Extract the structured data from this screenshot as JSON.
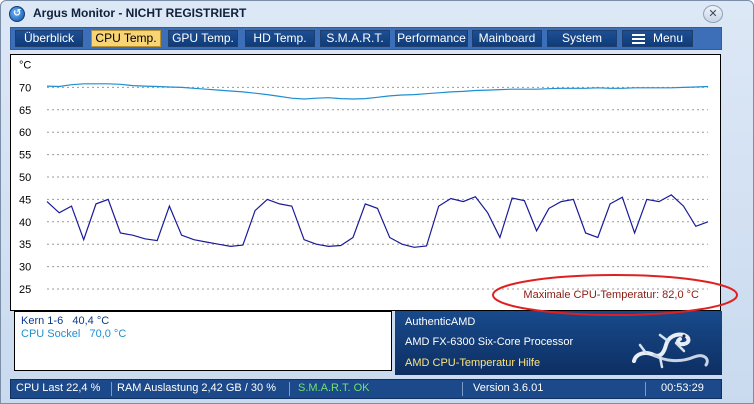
{
  "window": {
    "title": "Argus Monitor - NICHT REGISTRIERT",
    "close_icon": "close-icon"
  },
  "tabs": [
    {
      "label": "Überblick"
    },
    {
      "label": "CPU Temp.",
      "active": true
    },
    {
      "label": "GPU Temp."
    },
    {
      "label": "HD Temp."
    },
    {
      "label": "S.M.A.R.T."
    },
    {
      "label": "Performance"
    },
    {
      "label": "Mainboard"
    },
    {
      "label": "System"
    },
    {
      "label": "Menu",
      "icon": "menu-icon"
    }
  ],
  "chart_data": {
    "type": "line",
    "ylabel": "°C",
    "ylim": [
      25,
      75
    ],
    "yticks": [
      25,
      30,
      35,
      40,
      45,
      50,
      55,
      60,
      65,
      70
    ],
    "grid": true,
    "max_label": "Maximale CPU-Temperatur: 82,0 °C",
    "series": [
      {
        "name": "CPU Sockel",
        "color": "#1e8fd0",
        "values": [
          70.3,
          70.2,
          70.6,
          70.8,
          70.8,
          70.8,
          70.7,
          70.4,
          70.3,
          70.2,
          70.1,
          70.0,
          69.8,
          69.6,
          69.4,
          69.2,
          69.0,
          68.7,
          68.4,
          68.0,
          67.6,
          67.4,
          67.6,
          67.7,
          67.5,
          67.4,
          67.5,
          67.8,
          68.1,
          68.3,
          68.4,
          68.6,
          68.8,
          69.0,
          69.1,
          69.3,
          69.4,
          69.5,
          69.6,
          69.6,
          69.6,
          69.7,
          69.8,
          69.8,
          69.8,
          69.9,
          69.8,
          69.8,
          69.9,
          69.9,
          69.9,
          69.9,
          70.0,
          70.1,
          70.2
        ]
      },
      {
        "name": "Kern 1-6",
        "color": "#1a1a9a",
        "values": [
          44.5,
          42.0,
          43.5,
          36.0,
          44.0,
          45.0,
          37.5,
          37.0,
          36.2,
          35.8,
          43.5,
          37.0,
          36.0,
          35.5,
          35.0,
          34.5,
          34.8,
          42.5,
          45.0,
          44.0,
          43.5,
          36.0,
          35.0,
          34.5,
          34.7,
          36.5,
          44.0,
          43.0,
          36.5,
          35.0,
          34.3,
          34.6,
          43.5,
          45.2,
          44.5,
          45.6,
          42.0,
          36.5,
          45.3,
          44.7,
          38.0,
          43.0,
          44.5,
          45.0,
          37.5,
          36.5,
          44.0,
          45.5,
          37.5,
          45.0,
          44.5,
          46.0,
          43.5,
          39.0,
          40.0
        ]
      }
    ]
  },
  "info": {
    "kern": "Kern 1-6   40,4 °C",
    "sockel": "CPU Sockel   70,0 °C"
  },
  "cpu": {
    "vendor": "AuthenticAMD",
    "model": "AMD FX-6300 Six-Core Processor",
    "help": "AMD CPU-Temperatur Hilfe"
  },
  "status": {
    "cpu_load": "CPU Last 22,4 %",
    "ram": "RAM Auslastung 2,42 GB / 30 %",
    "smart": "S.M.A.R.T. OK",
    "version": "Version 3.6.01",
    "time": "00:53:29"
  },
  "colors": {
    "annotation": "#e02020",
    "max_label": "#8a1a10",
    "tabbar": "#3c6fb8",
    "active_tab": "#f8d474"
  }
}
